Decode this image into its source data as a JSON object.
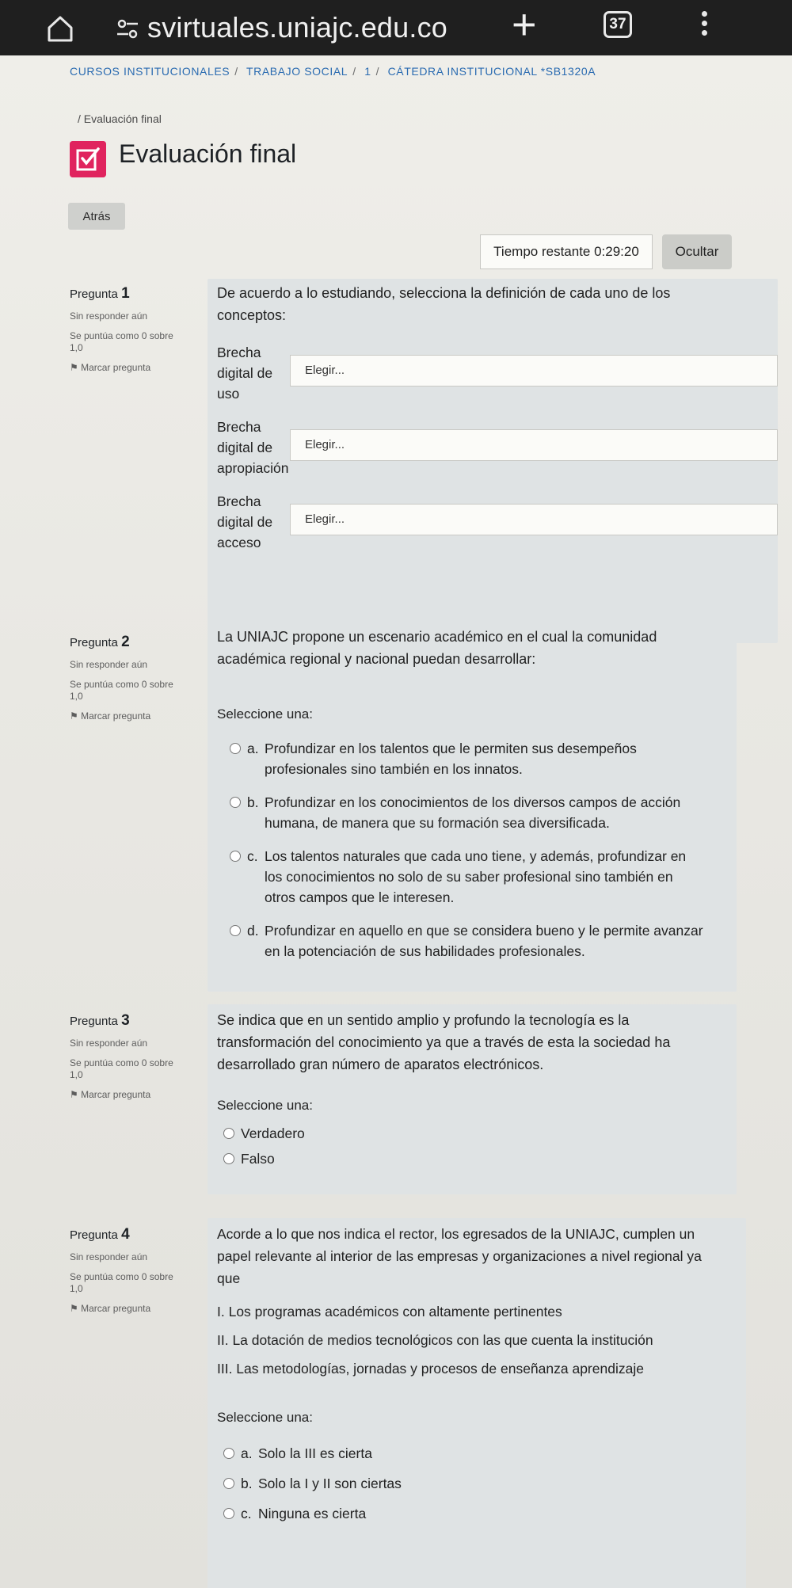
{
  "browser": {
    "url": "svirtuales.uniajc.edu.co",
    "tab_count": "37"
  },
  "breadcrumb": {
    "items": [
      "CURSOS INSTITUCIONALES",
      "TRABAJO SOCIAL",
      "1",
      "CÁTEDRA INSTITUCIONAL *SB1320A"
    ],
    "sub": "/ Evaluación final"
  },
  "header": {
    "title": "Evaluación final",
    "back_label": "Atrás"
  },
  "timer": {
    "label": "Tiempo restante 0:29:20",
    "hide_label": "Ocultar"
  },
  "questions": [
    {
      "number_prefix": "Pregunta",
      "number": "1",
      "status": "Sin responder aún",
      "score": "Se puntúa como 0 sobre 1,0",
      "flag": "Marcar pregunta",
      "text": "De acuerdo a lo estudiando, selecciona la definición de cada uno de los conceptos:",
      "matches": [
        {
          "label": [
            "Brecha",
            "digital de",
            "uso"
          ],
          "placeholder": "Elegir..."
        },
        {
          "label": [
            "Brecha",
            "digital de",
            "apropiación"
          ],
          "placeholder": "Elegir..."
        },
        {
          "label": [
            "Brecha",
            "digital de",
            "acceso"
          ],
          "placeholder": "Elegir..."
        }
      ]
    },
    {
      "number_prefix": "Pregunta",
      "number": "2",
      "status": "Sin responder aún",
      "score": "Se puntúa como 0 sobre 1,0",
      "flag": "Marcar pregunta",
      "text": "La UNIAJC propone un escenario académico en el cual la comunidad académica regional y nacional puedan desarrollar:",
      "select_label": "Seleccione una:",
      "options": [
        {
          "letter": "a.",
          "lines": [
            "Profundizar en los talentos que le permiten sus desempeños",
            "profesionales sino también en los innatos."
          ]
        },
        {
          "letter": "b.",
          "lines": [
            "Profundizar en los conocimientos de los diversos campos de acción",
            "humana, de manera que su formación sea diversificada."
          ]
        },
        {
          "letter": "c.",
          "lines": [
            "Los talentos naturales que cada uno tiene, y además, profundizar en",
            "los conocimientos no solo de su saber profesional sino también en",
            "otros campos que le interesen."
          ]
        },
        {
          "letter": "d.",
          "lines": [
            "Profundizar en aquello en que se considera bueno y le permite avanzar",
            "en la potenciación de sus habilidades profesionales."
          ]
        }
      ]
    },
    {
      "number_prefix": "Pregunta",
      "number": "3",
      "status": "Sin responder aún",
      "score": "Se puntúa como 0 sobre 1,0",
      "flag": "Marcar pregunta",
      "text_lines": [
        "Se indica que en un sentido amplio y profundo la tecnología es la",
        "transformación del conocimiento ya que a través de esta la sociedad ha",
        "desarrollado gran número de aparatos electrónicos."
      ],
      "select_label": "Seleccione una:",
      "options": [
        {
          "letter": "",
          "lines": [
            "Verdadero"
          ]
        },
        {
          "letter": "",
          "lines": [
            "Falso"
          ]
        }
      ]
    },
    {
      "number_prefix": "Pregunta",
      "number": "4",
      "status": "Sin responder aún",
      "score": "Se puntúa como 0 sobre 1,0",
      "flag": "Marcar pregunta",
      "text_lines": [
        "Acorde a lo que nos indica el rector, los egresados de la UNIAJC, cumplen un",
        "papel relevante al interior de las empresas y organizaciones a nivel regional ya",
        "que"
      ],
      "statements": [
        "I.  Los programas académicos con altamente pertinentes",
        "II. La dotación de medios tecnológicos con las que cuenta la institución",
        "III.  Las metodologías, jornadas y procesos de enseñanza aprendizaje"
      ],
      "select_label": "Seleccione una:",
      "options": [
        {
          "letter": "a.",
          "lines": [
            "Solo la III es cierta"
          ]
        },
        {
          "letter": "b.",
          "lines": [
            "Solo la I y II son ciertas"
          ]
        },
        {
          "letter": "c.",
          "lines": [
            "Ninguna es cierta"
          ]
        }
      ]
    }
  ],
  "colors": {
    "accent": "#e0245e",
    "link": "#2a6bb1",
    "question_bg": "#dfe3e4"
  }
}
